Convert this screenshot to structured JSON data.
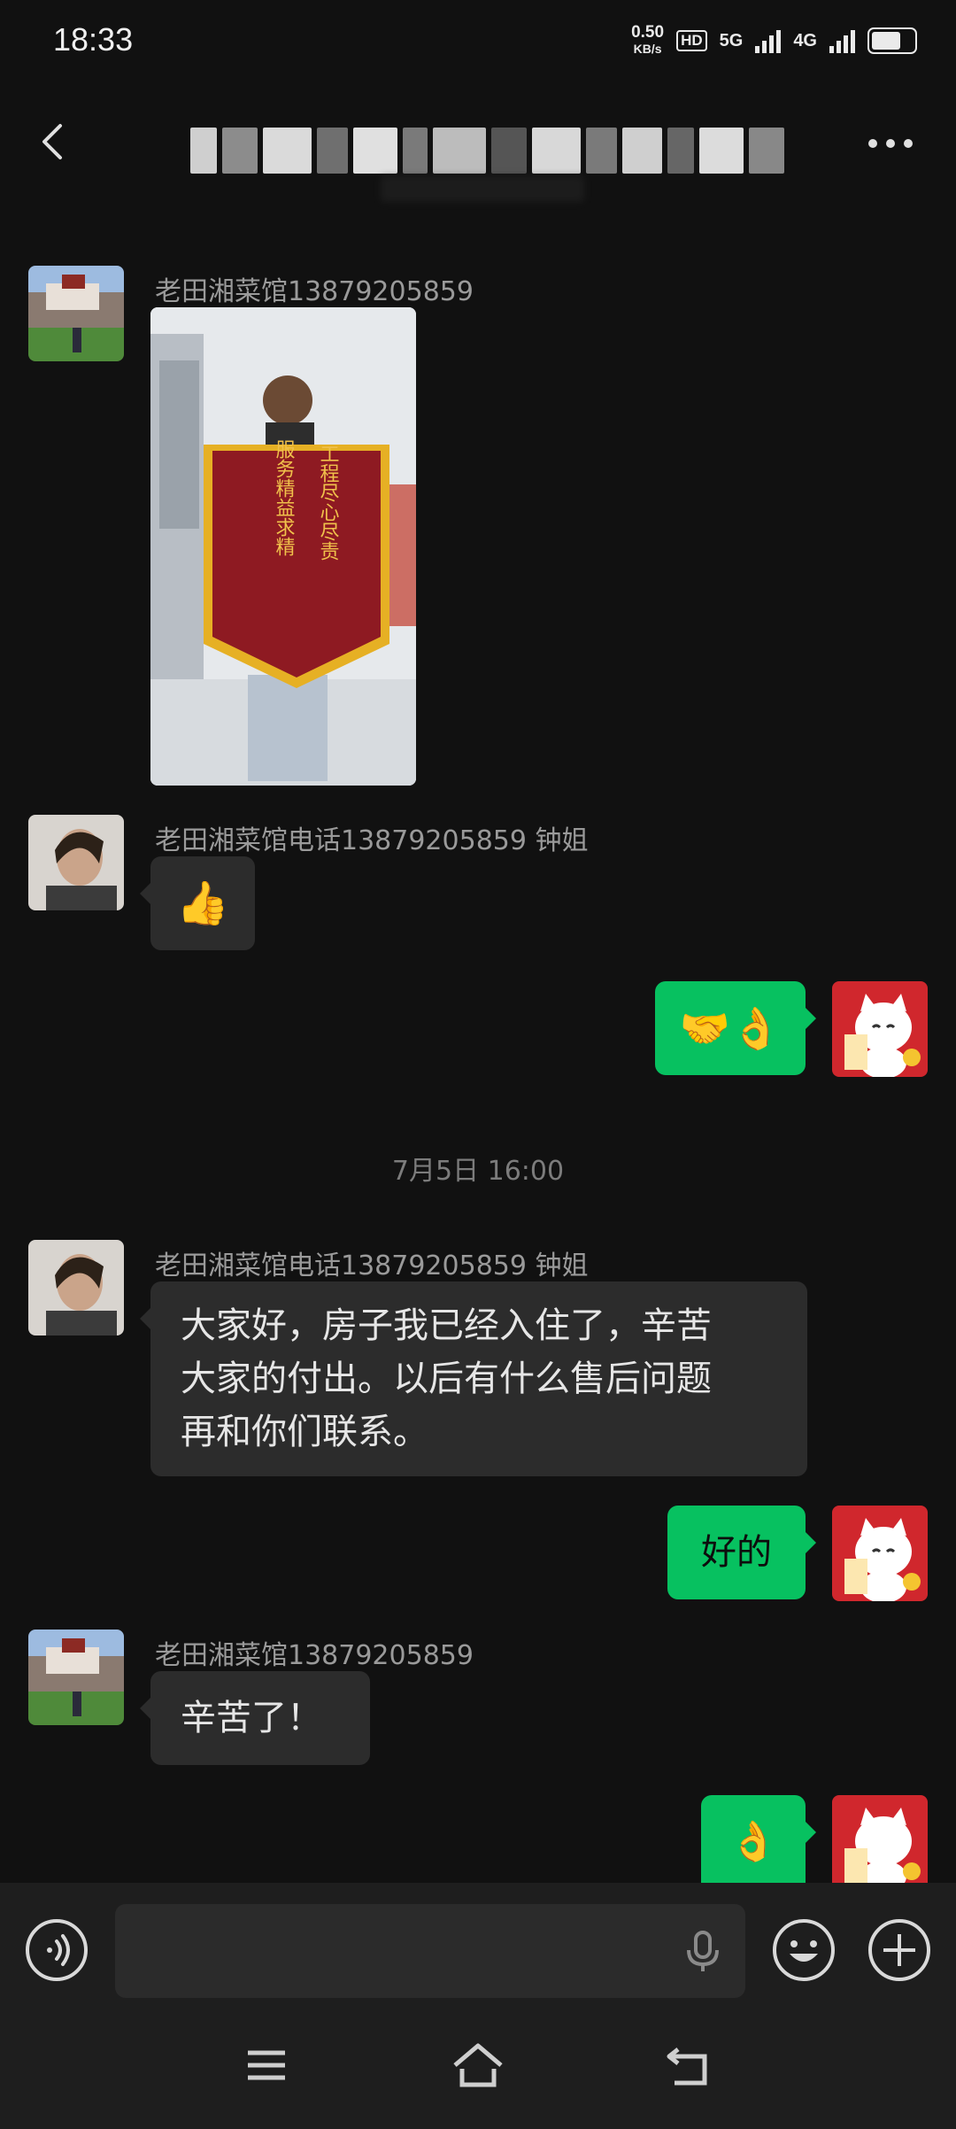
{
  "status_bar": {
    "time": "18:33",
    "net_speed_value": "0.50",
    "net_speed_unit": "KB/s",
    "hd_label": "HD",
    "sig1_label": "5G",
    "sig2_label": "4G"
  },
  "header": {
    "title_obscured": true
  },
  "messages": [
    {
      "type": "image",
      "side": "left",
      "sender": "老田湘菜馆13879205859",
      "banner_text": [
        "工程尽心尽责",
        "服务精益求精"
      ]
    },
    {
      "type": "emoji",
      "side": "left",
      "sender": "老田湘菜馆电话13879205859 钟姐",
      "content": "👍"
    },
    {
      "type": "emoji",
      "side": "right",
      "content": "🤝👌"
    },
    {
      "type": "timestamp",
      "text": "7月5日 16:00"
    },
    {
      "type": "text",
      "side": "left",
      "sender": "老田湘菜馆电话13879205859 钟姐",
      "lines": [
        "大家好，房子我已经入住了，辛苦",
        "大家的付出。以后有什么售后问题",
        "再和你们联系。"
      ]
    },
    {
      "type": "text",
      "side": "right",
      "content": "好的"
    },
    {
      "type": "text",
      "side": "left",
      "sender": "老田湘菜馆13879205859",
      "content": "辛苦了！"
    },
    {
      "type": "emoji",
      "side": "right",
      "content": "👌"
    }
  ],
  "icons": {
    "back": "back-icon",
    "more": "more-icon",
    "voice": "voice-icon",
    "mic": "mic-icon",
    "emoji": "emoji-icon",
    "plus": "plus-icon",
    "nav_menu": "menu-icon",
    "nav_home": "home-icon",
    "nav_back": "nav-back-icon"
  },
  "colors": {
    "accent": "#07c160",
    "background": "#111111",
    "bubble_in": "#2c2c2c"
  }
}
